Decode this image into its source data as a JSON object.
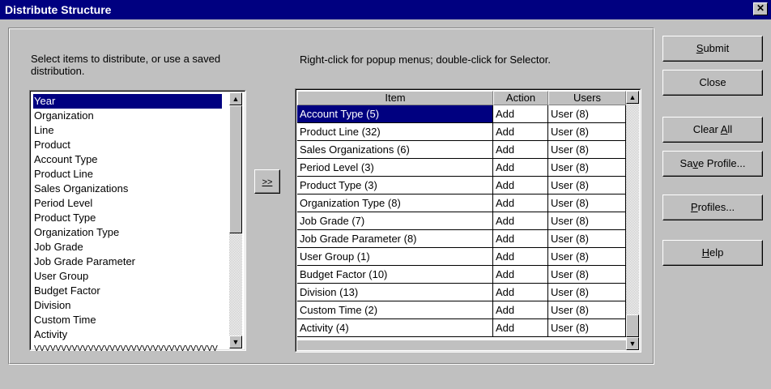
{
  "window": {
    "title": "Distribute Structure"
  },
  "left_panel": {
    "instruction": "Select items to distribute, or use a saved distribution.",
    "items": [
      "Year",
      "Organization",
      "Line",
      "Product",
      "Account Type",
      "Product Line",
      "Sales Organizations",
      "Period Level",
      "Product Type",
      "Organization Type",
      "Job Grade",
      "Job Grade Parameter",
      "User Group",
      "Budget Factor",
      "Division",
      "Custom Time",
      "Activity",
      "VVVVVVVVVVVVVVVVVVVVVVVVVVVVVVVVVV"
    ],
    "selected_index": 0
  },
  "move_button": {
    "label": ">>"
  },
  "right_panel": {
    "instruction": "Right-click for popup menus; double-click for Selector.",
    "columns": [
      "Item",
      "Action",
      "Users"
    ],
    "rows": [
      [
        "Account Type (5)",
        "Add",
        "User (8)"
      ],
      [
        "Product Line (32)",
        "Add",
        "User (8)"
      ],
      [
        "Sales Organizations (6)",
        "Add",
        "User (8)"
      ],
      [
        "Period Level (3)",
        "Add",
        "User (8)"
      ],
      [
        "Product Type (3)",
        "Add",
        "User (8)"
      ],
      [
        "Organization Type (8)",
        "Add",
        "User (8)"
      ],
      [
        "Job Grade (7)",
        "Add",
        "User (8)"
      ],
      [
        "Job Grade Parameter (8)",
        "Add",
        "User (8)"
      ],
      [
        "User Group (1)",
        "Add",
        "User (8)"
      ],
      [
        "Budget Factor (10)",
        "Add",
        "User (8)"
      ],
      [
        "Division (13)",
        "Add",
        "User (8)"
      ],
      [
        "Custom Time (2)",
        "Add",
        "User (8)"
      ],
      [
        "Activity (4)",
        "Add",
        "User (8)"
      ]
    ],
    "selected_row": 0
  },
  "buttons": {
    "submit": {
      "pre": "",
      "key": "S",
      "post": "ubmit"
    },
    "close": {
      "pre": "Close",
      "key": "",
      "post": ""
    },
    "clear_all": {
      "pre": "Clear ",
      "key": "A",
      "post": "ll"
    },
    "save_profile": {
      "pre": "Sa",
      "key": "v",
      "post": "e Profile..."
    },
    "profiles": {
      "pre": "",
      "key": "P",
      "post": "rofiles..."
    },
    "help": {
      "pre": "",
      "key": "H",
      "post": "elp"
    }
  }
}
